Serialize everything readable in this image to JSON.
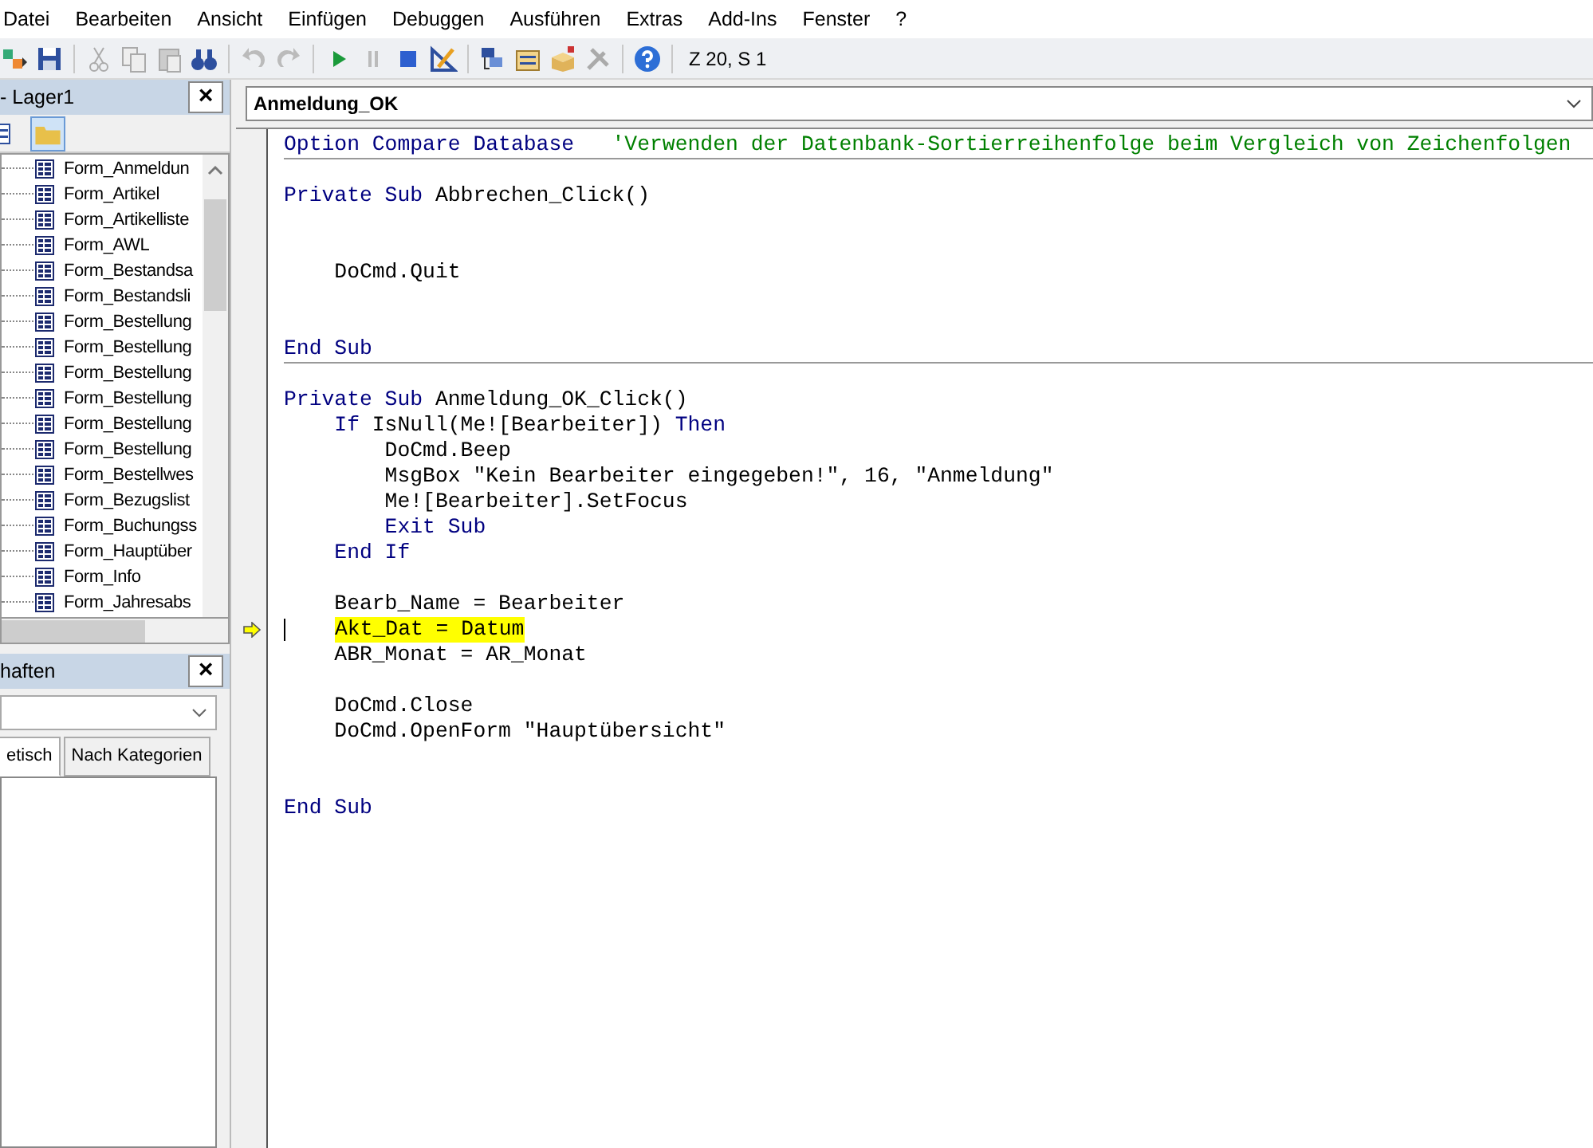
{
  "menu": [
    {
      "label": "Datei"
    },
    {
      "label": "Bearbeiten"
    },
    {
      "label": "Ansicht"
    },
    {
      "label": "Einfügen"
    },
    {
      "label": "Debuggen"
    },
    {
      "label": "Ausführen"
    },
    {
      "label": "Extras"
    },
    {
      "label": "Add-Ins"
    },
    {
      "label": "Fenster"
    },
    {
      "label": "?"
    }
  ],
  "toolbar": {
    "position": "Z 20, S 1"
  },
  "project": {
    "title": "- Lager1",
    "close": "×",
    "items": [
      {
        "label": "Form_Anmeldun"
      },
      {
        "label": "Form_Artikel"
      },
      {
        "label": "Form_Artikelliste"
      },
      {
        "label": "Form_AWL"
      },
      {
        "label": "Form_Bestandsa"
      },
      {
        "label": "Form_Bestandsli"
      },
      {
        "label": "Form_Bestellung"
      },
      {
        "label": "Form_Bestellung"
      },
      {
        "label": "Form_Bestellung"
      },
      {
        "label": "Form_Bestellung"
      },
      {
        "label": "Form_Bestellung"
      },
      {
        "label": "Form_Bestellung"
      },
      {
        "label": "Form_Bestellwes"
      },
      {
        "label": "Form_Bezugslist"
      },
      {
        "label": "Form_Buchungss"
      },
      {
        "label": "Form_Hauptüber"
      },
      {
        "label": "Form_Info"
      },
      {
        "label": "Form_Jahresabs"
      }
    ]
  },
  "properties": {
    "title": "haften",
    "close": "×",
    "tabs": [
      {
        "label": "etisch",
        "selected": true
      },
      {
        "label": "Nach Kategorien",
        "selected": false
      }
    ]
  },
  "code_window": {
    "procedure": "Anmeldung_OK",
    "sections": [
      {
        "lines": [
          {
            "kind": "code",
            "segments": [
              {
                "kind": "keyword",
                "text": "Option Compare Database"
              },
              {
                "kind": "comment",
                "text": "   'Verwenden der Datenbank-Sortierreihenfolge beim Vergleich von Zeichenfolgen"
              }
            ]
          }
        ]
      },
      {
        "lines": [
          {
            "kind": "blank"
          },
          {
            "kind": "code",
            "segments": [
              {
                "kind": "keyword",
                "text": "Private Sub"
              },
              {
                "kind": "plain",
                "text": " Abbrechen_Click()"
              }
            ]
          },
          {
            "kind": "blank"
          },
          {
            "kind": "blank"
          },
          {
            "kind": "code",
            "segments": [
              {
                "kind": "plain",
                "text": "    DoCmd.Quit"
              }
            ]
          },
          {
            "kind": "blank"
          },
          {
            "kind": "blank"
          },
          {
            "kind": "code",
            "segments": [
              {
                "kind": "keyword",
                "text": "End Sub"
              }
            ]
          }
        ]
      },
      {
        "lines": [
          {
            "kind": "blank"
          },
          {
            "kind": "code",
            "segments": [
              {
                "kind": "keyword",
                "text": "Private Sub"
              },
              {
                "kind": "plain",
                "text": " Anmeldung_OK_Click()"
              }
            ]
          },
          {
            "kind": "code",
            "segments": [
              {
                "kind": "keyword",
                "text": "    If"
              },
              {
                "kind": "plain",
                "text": " IsNull(Me![Bearbeiter]) "
              },
              {
                "kind": "keyword",
                "text": "Then"
              }
            ]
          },
          {
            "kind": "code",
            "segments": [
              {
                "kind": "plain",
                "text": "        DoCmd.Beep"
              }
            ]
          },
          {
            "kind": "code",
            "segments": [
              {
                "kind": "plain",
                "text": "        MsgBox \"Kein Bearbeiter eingegeben!\", 16, \"Anmeldung\""
              }
            ]
          },
          {
            "kind": "code",
            "segments": [
              {
                "kind": "plain",
                "text": "        Me![Bearbeiter].SetFocus"
              }
            ]
          },
          {
            "kind": "code",
            "segments": [
              {
                "kind": "keyword",
                "text": "        Exit Sub"
              }
            ]
          },
          {
            "kind": "code",
            "segments": [
              {
                "kind": "keyword",
                "text": "    End If"
              }
            ]
          },
          {
            "kind": "blank"
          },
          {
            "kind": "code",
            "segments": [
              {
                "kind": "plain",
                "text": "    Bearb_Name = Bearbeiter"
              }
            ]
          },
          {
            "kind": "code",
            "current": true,
            "segments": [
              {
                "kind": "plain",
                "text": "Akt_Dat = Datum"
              }
            ]
          },
          {
            "kind": "code",
            "segments": [
              {
                "kind": "plain",
                "text": "    ABR_Monat = AR_Monat"
              }
            ]
          },
          {
            "kind": "blank"
          },
          {
            "kind": "code",
            "segments": [
              {
                "kind": "plain",
                "text": "    DoCmd.Close"
              }
            ]
          },
          {
            "kind": "code",
            "segments": [
              {
                "kind": "plain",
                "text": "    DoCmd.OpenForm \"Hauptübersicht\""
              }
            ]
          },
          {
            "kind": "blank"
          },
          {
            "kind": "blank"
          },
          {
            "kind": "code",
            "segments": [
              {
                "kind": "keyword",
                "text": "End Sub"
              }
            ]
          }
        ]
      }
    ]
  }
}
